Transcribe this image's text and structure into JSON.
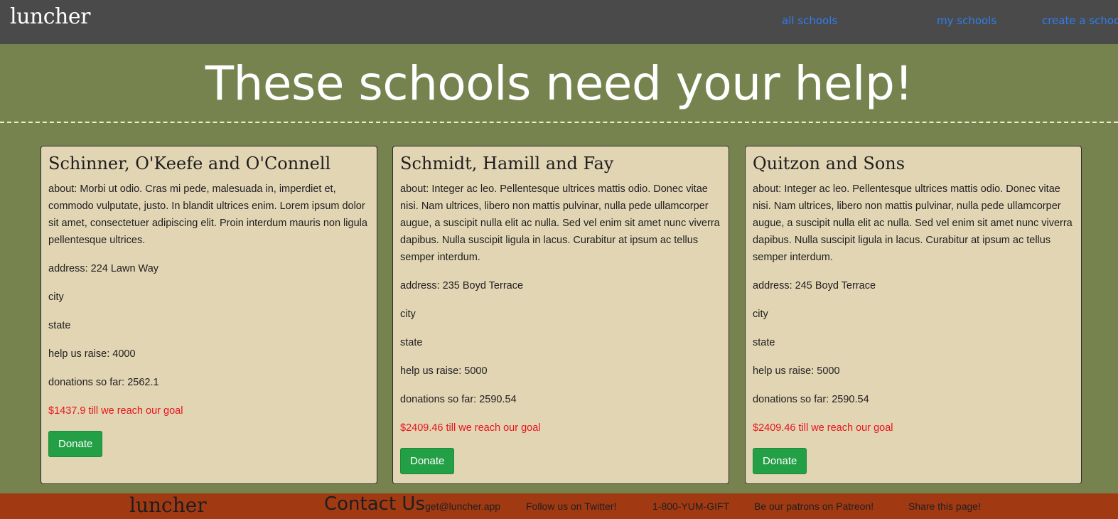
{
  "header": {
    "brand": "luncher",
    "nav": {
      "all_schools": "all schools",
      "my_schools": "my schools",
      "create_school": "create a school"
    }
  },
  "hero": {
    "title": "These schools need your help!"
  },
  "schools": [
    {
      "name": "Schinner, O'Keefe and O'Connell",
      "about": "about: Morbi ut odio. Cras mi pede, malesuada in, imperdiet et, commodo vulputate, justo. In blandit ultrices enim. Lorem ipsum dolor sit amet, consectetuer adipiscing elit. Proin interdum mauris non ligula pellentesque ultrices.",
      "address": "address: 224 Lawn Way",
      "city": "city",
      "state": "state",
      "goal": "help us raise: 4000",
      "donations": "donations so far: 2562.1",
      "remaining": "$1437.9 till we reach our goal",
      "donate_label": "Donate"
    },
    {
      "name": "Schmidt, Hamill and Fay",
      "about": "about: Integer ac leo. Pellentesque ultrices mattis odio. Donec vitae nisi. Nam ultrices, libero non mattis pulvinar, nulla pede ullamcorper augue, a suscipit nulla elit ac nulla. Sed vel enim sit amet nunc viverra dapibus. Nulla suscipit ligula in lacus. Curabitur at ipsum ac tellus semper interdum.",
      "address": "address: 235 Boyd Terrace",
      "city": "city",
      "state": "state",
      "goal": "help us raise: 5000",
      "donations": "donations so far: 2590.54",
      "remaining": "$2409.46 till we reach our goal",
      "donate_label": "Donate"
    },
    {
      "name": "Quitzon and Sons",
      "about": "about: Integer ac leo. Pellentesque ultrices mattis odio. Donec vitae nisi. Nam ultrices, libero non mattis pulvinar, nulla pede ullamcorper augue, a suscipit nulla elit ac nulla. Sed vel enim sit amet nunc viverra dapibus. Nulla suscipit ligula in lacus. Curabitur at ipsum ac tellus semper interdum.",
      "address": "address: 245 Boyd Terrace",
      "city": "city",
      "state": "state",
      "goal": "help us raise: 5000",
      "donations": "donations so far: 2590.54",
      "remaining": "$2409.46 till we reach our goal",
      "donate_label": "Donate"
    }
  ],
  "footer": {
    "brand": "luncher",
    "contact_heading": "Contact Us",
    "email": "get@luncher.app",
    "twitter": "Follow us on Twitter!",
    "phone": "1-800-YUM-GIFT",
    "patreon": "Be our patrons on Patreon!",
    "share": "Share this page!"
  },
  "colors": {
    "header_bg": "#4a4a4a",
    "page_bg": "#77834f",
    "card_bg": "#e2d5b4",
    "footer_bg": "#a13a13",
    "link": "#2f7ef0",
    "remaining_text": "#e8141c",
    "donate_button": "#23a045"
  }
}
